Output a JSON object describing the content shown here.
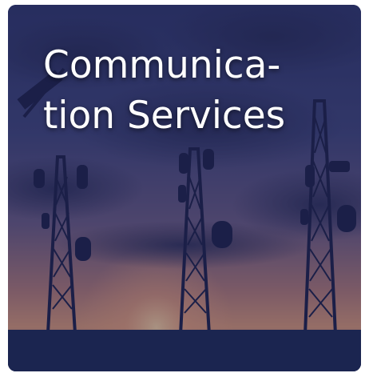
{
  "tile": {
    "title_line_1": "Communica-",
    "title_line_2": "tion Services",
    "image_subject": "telecommunication-towers-at-sunset",
    "colors": {
      "overlay": "#19204e",
      "ground": "#1b2550",
      "sky_glow": "#e7a277",
      "tower": "#1c2046",
      "title_text": "#ffffff"
    }
  }
}
